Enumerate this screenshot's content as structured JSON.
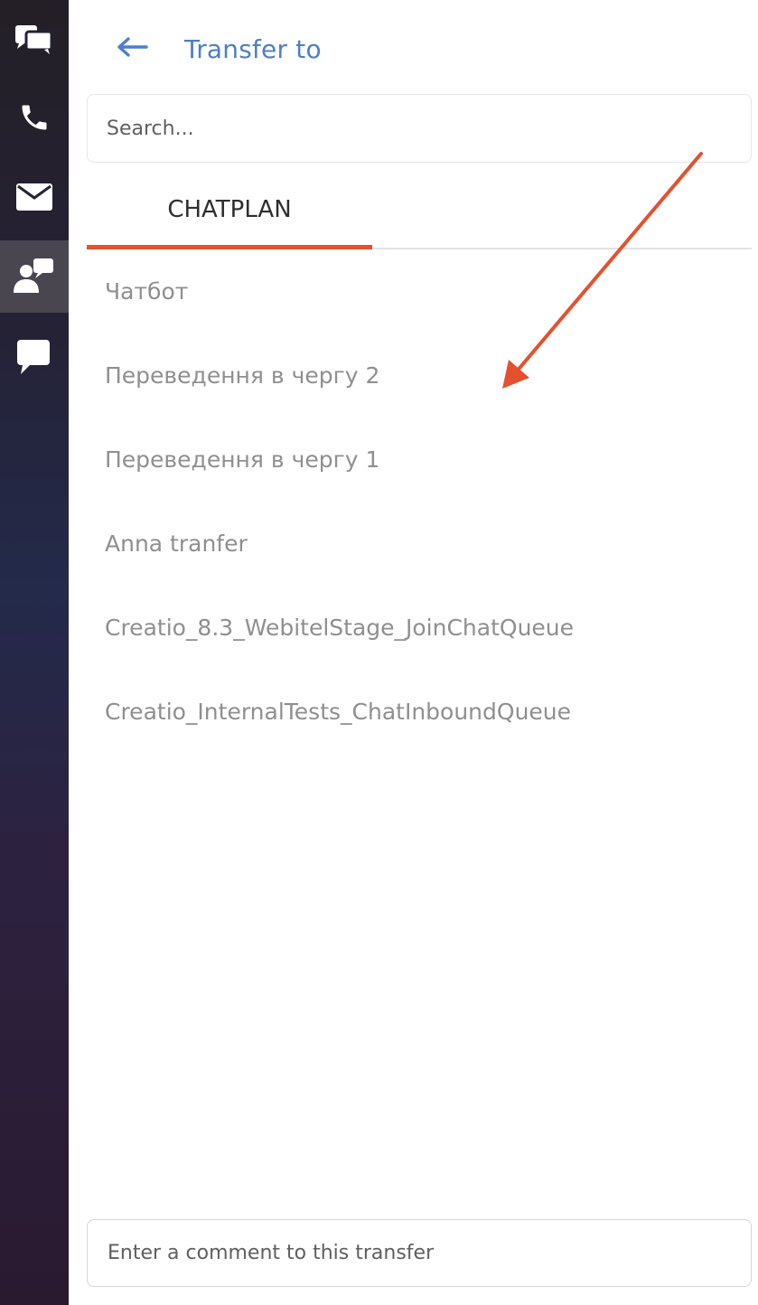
{
  "sidebar": {
    "items": [
      {
        "icon": "chats-icon"
      },
      {
        "icon": "phone-icon"
      },
      {
        "icon": "mail-icon"
      },
      {
        "icon": "user-chat-icon",
        "active": true
      },
      {
        "icon": "chat-bubble-icon"
      }
    ]
  },
  "header": {
    "back_icon": "arrow-left-icon",
    "title": "Transfer to"
  },
  "search": {
    "placeholder": "Search..."
  },
  "tabs": [
    {
      "label": "CHATPLAN",
      "active": true
    }
  ],
  "chatplan_items": [
    "Чатбот",
    "Переведення в чергу 2",
    "Переведення в чергу 1",
    "Anna tranfer",
    "Creatio_8.3_WebitelStage_JoinChatQueue",
    "Creatio_InternalTests_ChatInboundQueue"
  ],
  "comment": {
    "placeholder": "Enter a comment to this transfer"
  },
  "colors": {
    "accent": "#e4512f",
    "title": "#4e7fca",
    "item_text": "#8f8f8f"
  }
}
